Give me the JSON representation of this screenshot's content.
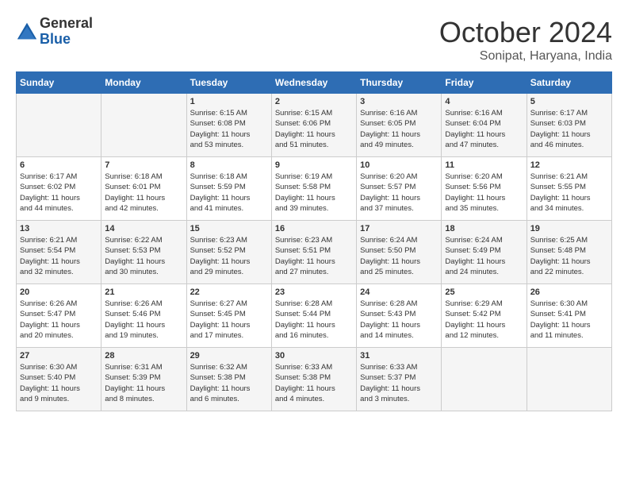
{
  "logo": {
    "general": "General",
    "blue": "Blue"
  },
  "title": "October 2024",
  "location": "Sonipat, Haryana, India",
  "headers": [
    "Sunday",
    "Monday",
    "Tuesday",
    "Wednesday",
    "Thursday",
    "Friday",
    "Saturday"
  ],
  "weeks": [
    [
      {
        "day": "",
        "info": ""
      },
      {
        "day": "",
        "info": ""
      },
      {
        "day": "1",
        "info": "Sunrise: 6:15 AM\nSunset: 6:08 PM\nDaylight: 11 hours\nand 53 minutes."
      },
      {
        "day": "2",
        "info": "Sunrise: 6:15 AM\nSunset: 6:06 PM\nDaylight: 11 hours\nand 51 minutes."
      },
      {
        "day": "3",
        "info": "Sunrise: 6:16 AM\nSunset: 6:05 PM\nDaylight: 11 hours\nand 49 minutes."
      },
      {
        "day": "4",
        "info": "Sunrise: 6:16 AM\nSunset: 6:04 PM\nDaylight: 11 hours\nand 47 minutes."
      },
      {
        "day": "5",
        "info": "Sunrise: 6:17 AM\nSunset: 6:03 PM\nDaylight: 11 hours\nand 46 minutes."
      }
    ],
    [
      {
        "day": "6",
        "info": "Sunrise: 6:17 AM\nSunset: 6:02 PM\nDaylight: 11 hours\nand 44 minutes."
      },
      {
        "day": "7",
        "info": "Sunrise: 6:18 AM\nSunset: 6:01 PM\nDaylight: 11 hours\nand 42 minutes."
      },
      {
        "day": "8",
        "info": "Sunrise: 6:18 AM\nSunset: 5:59 PM\nDaylight: 11 hours\nand 41 minutes."
      },
      {
        "day": "9",
        "info": "Sunrise: 6:19 AM\nSunset: 5:58 PM\nDaylight: 11 hours\nand 39 minutes."
      },
      {
        "day": "10",
        "info": "Sunrise: 6:20 AM\nSunset: 5:57 PM\nDaylight: 11 hours\nand 37 minutes."
      },
      {
        "day": "11",
        "info": "Sunrise: 6:20 AM\nSunset: 5:56 PM\nDaylight: 11 hours\nand 35 minutes."
      },
      {
        "day": "12",
        "info": "Sunrise: 6:21 AM\nSunset: 5:55 PM\nDaylight: 11 hours\nand 34 minutes."
      }
    ],
    [
      {
        "day": "13",
        "info": "Sunrise: 6:21 AM\nSunset: 5:54 PM\nDaylight: 11 hours\nand 32 minutes."
      },
      {
        "day": "14",
        "info": "Sunrise: 6:22 AM\nSunset: 5:53 PM\nDaylight: 11 hours\nand 30 minutes."
      },
      {
        "day": "15",
        "info": "Sunrise: 6:23 AM\nSunset: 5:52 PM\nDaylight: 11 hours\nand 29 minutes."
      },
      {
        "day": "16",
        "info": "Sunrise: 6:23 AM\nSunset: 5:51 PM\nDaylight: 11 hours\nand 27 minutes."
      },
      {
        "day": "17",
        "info": "Sunrise: 6:24 AM\nSunset: 5:50 PM\nDaylight: 11 hours\nand 25 minutes."
      },
      {
        "day": "18",
        "info": "Sunrise: 6:24 AM\nSunset: 5:49 PM\nDaylight: 11 hours\nand 24 minutes."
      },
      {
        "day": "19",
        "info": "Sunrise: 6:25 AM\nSunset: 5:48 PM\nDaylight: 11 hours\nand 22 minutes."
      }
    ],
    [
      {
        "day": "20",
        "info": "Sunrise: 6:26 AM\nSunset: 5:47 PM\nDaylight: 11 hours\nand 20 minutes."
      },
      {
        "day": "21",
        "info": "Sunrise: 6:26 AM\nSunset: 5:46 PM\nDaylight: 11 hours\nand 19 minutes."
      },
      {
        "day": "22",
        "info": "Sunrise: 6:27 AM\nSunset: 5:45 PM\nDaylight: 11 hours\nand 17 minutes."
      },
      {
        "day": "23",
        "info": "Sunrise: 6:28 AM\nSunset: 5:44 PM\nDaylight: 11 hours\nand 16 minutes."
      },
      {
        "day": "24",
        "info": "Sunrise: 6:28 AM\nSunset: 5:43 PM\nDaylight: 11 hours\nand 14 minutes."
      },
      {
        "day": "25",
        "info": "Sunrise: 6:29 AM\nSunset: 5:42 PM\nDaylight: 11 hours\nand 12 minutes."
      },
      {
        "day": "26",
        "info": "Sunrise: 6:30 AM\nSunset: 5:41 PM\nDaylight: 11 hours\nand 11 minutes."
      }
    ],
    [
      {
        "day": "27",
        "info": "Sunrise: 6:30 AM\nSunset: 5:40 PM\nDaylight: 11 hours\nand 9 minutes."
      },
      {
        "day": "28",
        "info": "Sunrise: 6:31 AM\nSunset: 5:39 PM\nDaylight: 11 hours\nand 8 minutes."
      },
      {
        "day": "29",
        "info": "Sunrise: 6:32 AM\nSunset: 5:38 PM\nDaylight: 11 hours\nand 6 minutes."
      },
      {
        "day": "30",
        "info": "Sunrise: 6:33 AM\nSunset: 5:38 PM\nDaylight: 11 hours\nand 4 minutes."
      },
      {
        "day": "31",
        "info": "Sunrise: 6:33 AM\nSunset: 5:37 PM\nDaylight: 11 hours\nand 3 minutes."
      },
      {
        "day": "",
        "info": ""
      },
      {
        "day": "",
        "info": ""
      }
    ]
  ]
}
